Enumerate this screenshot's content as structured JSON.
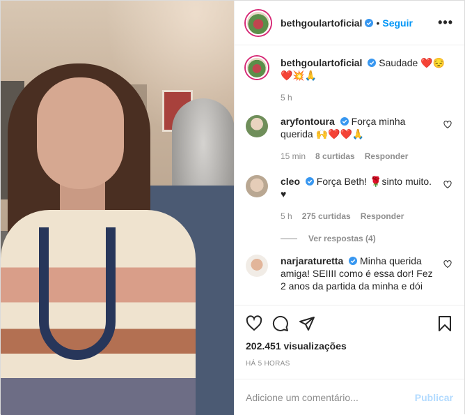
{
  "post": {
    "username": "bethgoulartoficial",
    "follow_label": "Seguir",
    "separator": "•",
    "more_label": "•••",
    "caption": {
      "username": "bethgoulartoficial",
      "text": "Saudade ❤️😔 ❤️💥🙏",
      "time": "5 h"
    }
  },
  "comments": [
    {
      "username": "aryfontoura",
      "text": "Força minha querida 🙌❤️❤️🙏",
      "time": "15 min",
      "likes": "8 curtidas",
      "reply_label": "Responder"
    },
    {
      "username": "cleo",
      "text": "Força Beth! 🌹sinto muito. ♥",
      "time": "5 h",
      "likes": "275 curtidas",
      "reply_label": "Responder",
      "view_replies": "Ver respostas (4)"
    },
    {
      "username": "narjaraturetta",
      "text": "Minha querida amiga! SEIIII como é essa dor! Fez 2 anos da partida da minha e dói"
    }
  ],
  "stats": {
    "views": "202.451 visualizações",
    "posted_ago": "HÁ 5 HORAS"
  },
  "comment_box": {
    "placeholder": "Adicione um comentário...",
    "publish_label": "Publicar"
  },
  "colors": {
    "accent": "#0095f6",
    "verified": "#3897f0",
    "publish_disabled": "#b3dbff"
  },
  "icons": [
    "verified-badge-icon",
    "more-icon",
    "heart-icon",
    "comment-icon",
    "share-icon",
    "bookmark-icon",
    "small-heart-icon"
  ]
}
